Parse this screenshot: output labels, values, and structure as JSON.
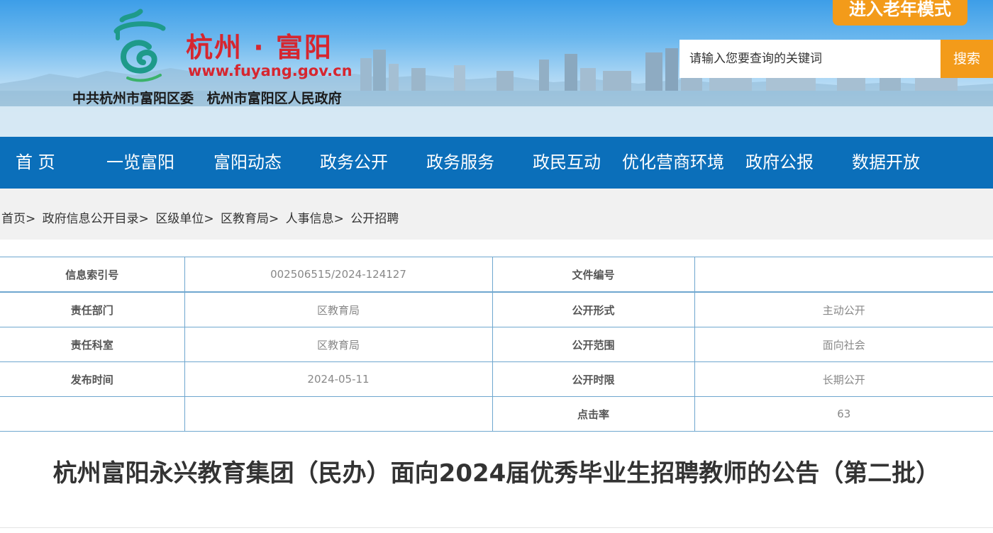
{
  "header": {
    "site_title": "杭州 · 富阳",
    "site_url": "www.fuyang.gov.cn",
    "site_subtitle": "中共杭州市富阳区委   杭州市富阳区人民政府",
    "elder_mode_label": "进入老年模式",
    "search_placeholder": "请输入您要查询的关键词",
    "search_button": "搜索"
  },
  "nav": {
    "items": [
      "首 页",
      "一览富阳",
      "富阳动态",
      "政务公开",
      "政务服务",
      "政民互动",
      "优化营商环境",
      "政府公报",
      "数据开放"
    ]
  },
  "breadcrumb": {
    "items": [
      "首页",
      "政府信息公开目录",
      "区级单位",
      "区教育局",
      "人事信息",
      "公开招聘"
    ]
  },
  "info_table": {
    "rows": [
      {
        "label1": "信息索引号",
        "value1": "002506515/2024-124127",
        "label2": "文件编号",
        "value2": ""
      },
      {
        "label1": "责任部门",
        "value1": "区教育局",
        "label2": "公开形式",
        "value2": "主动公开"
      },
      {
        "label1": "责任科室",
        "value1": "区教育局",
        "label2": "公开范围",
        "value2": "面向社会"
      },
      {
        "label1": "发布时间",
        "value1": "2024-05-11",
        "label2": "公开时限",
        "value2": "长期公开"
      },
      {
        "label1": "",
        "value1": "",
        "label2": "点击率",
        "value2": "63"
      }
    ]
  },
  "article": {
    "title": "杭州富阳永兴教育集团（民办）面向2024届优秀毕业生招聘教师的公告（第二批）"
  },
  "colors": {
    "nav_bg": "#0b6fba",
    "accent_orange": "#f39b1a",
    "title_red": "#d6262f"
  }
}
